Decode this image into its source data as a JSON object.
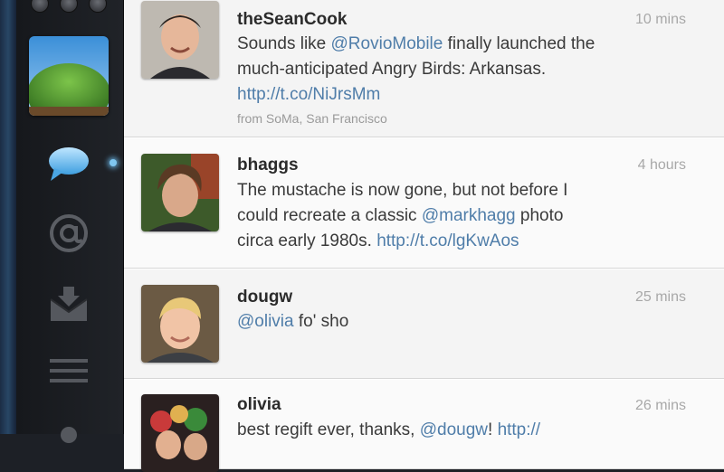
{
  "sidebar": {
    "nav": [
      {
        "icon": "speech-bubble-icon",
        "active": true
      },
      {
        "icon": "at-sign-icon",
        "active": false
      },
      {
        "icon": "inbox-tray-icon",
        "active": false
      },
      {
        "icon": "list-lines-icon",
        "active": false
      }
    ]
  },
  "tweets": [
    {
      "username": "theSeanCook",
      "time": "10 mins",
      "lines": [
        [
          {
            "t": "Sounds like "
          },
          {
            "t": "@RovioMobile",
            "link": true
          },
          {
            "t": " finally launched the"
          }
        ],
        [
          {
            "t": "much-anticipated Angry Birds: Arkansas."
          }
        ],
        [
          {
            "t": "http://t.co/NiJrsMm",
            "link": true
          }
        ]
      ],
      "source": "from SoMa, San Francisco"
    },
    {
      "username": "bhaggs",
      "time": "4 hours",
      "lines": [
        [
          {
            "t": "The mustache is now gone, but not before I"
          }
        ],
        [
          {
            "t": "could recreate a classic "
          },
          {
            "t": "@markhagg",
            "link": true
          },
          {
            "t": " photo"
          }
        ],
        [
          {
            "t": "circa early 1980s. "
          },
          {
            "t": "http://t.co/lgKwAos",
            "link": true
          }
        ]
      ]
    },
    {
      "username": "dougw",
      "time": "25 mins",
      "lines": [
        [
          {
            "t": "@olivia",
            "link": true
          },
          {
            "t": " fo' sho"
          }
        ]
      ]
    },
    {
      "username": "olivia",
      "time": "26 mins",
      "lines": [
        [
          {
            "t": "best regift ever, thanks, "
          },
          {
            "t": "@dougw",
            "link": true
          },
          {
            "t": "! "
          },
          {
            "t": "http://",
            "link": true
          }
        ]
      ]
    }
  ],
  "colors": {
    "link": "#4f7da9",
    "active_glow": "#7fc6ef"
  }
}
